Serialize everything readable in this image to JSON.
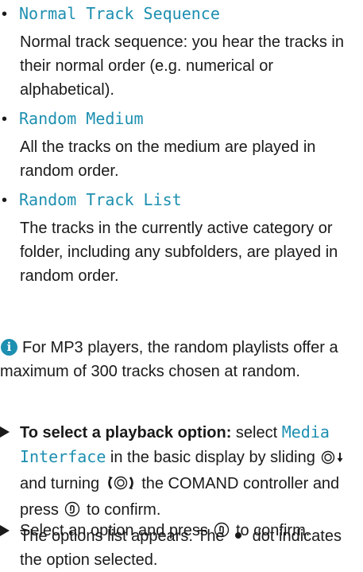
{
  "options": [
    {
      "bullet": "•",
      "title": "Normal Track Sequence",
      "description": "Normal track sequence: you hear the tracks in their normal order (e.g. numerical or alphabetical)."
    },
    {
      "bullet": "•",
      "title": "Random Medium",
      "description": "All the tracks on the medium are played in random order."
    },
    {
      "bullet": "•",
      "title": "Random Track List",
      "description": "The tracks in the currently active category or folder, including any subfolders, are played in random order."
    }
  ],
  "info": {
    "icon": "info-icon",
    "icon_glyph": "i",
    "text": "For MP3 players, the random playlists offer a maximum of 300 tracks chosen at random."
  },
  "step1": {
    "lead": "To select a playback option:",
    "part1": " select ",
    "menu_item": "Media Interface",
    "part2": " in the basic display by sliding ",
    "part3": " and turning ",
    "part4": " the COMAND controller and press ",
    "part5": " to confirm.",
    "result1": "The options list appears. The ",
    "result2": " dot indicates the option selected."
  },
  "step2": {
    "text1": "Select an option and press ",
    "text2": " to confirm."
  },
  "colors": {
    "accent": "#1d8fb0",
    "text": "#1a1a1a"
  }
}
